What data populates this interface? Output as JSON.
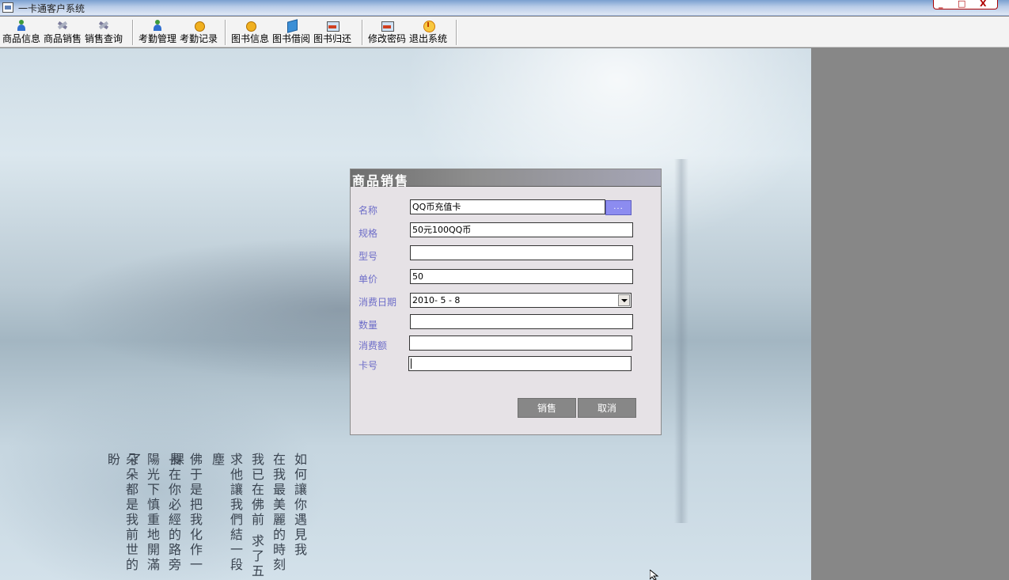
{
  "window": {
    "title": "一卡通客户系统",
    "controls": {
      "minimize": "_",
      "maximize": "□",
      "close": "X"
    }
  },
  "toolbar": {
    "groups": [
      [
        {
          "label": "商品信息",
          "icon": "person-icon"
        },
        {
          "label": "商品销售",
          "icon": "tools-icon"
        },
        {
          "label": "销售查询",
          "icon": "tools-icon"
        }
      ],
      [
        {
          "label": "考勤管理",
          "icon": "person-icon"
        },
        {
          "label": "考勤记录",
          "icon": "coin-icon"
        }
      ],
      [
        {
          "label": "图书信息",
          "icon": "coin-icon"
        },
        {
          "label": "图书借阅",
          "icon": "book-icon"
        },
        {
          "label": "图书归还",
          "icon": "picture-icon"
        }
      ],
      [
        {
          "label": "修改密码",
          "icon": "picture-icon"
        },
        {
          "label": "退出系统",
          "icon": "power-icon"
        }
      ]
    ]
  },
  "dialog": {
    "title": "商品销售",
    "fields": {
      "name": {
        "label": "名称",
        "value": "QQ币充值卡"
      },
      "spec": {
        "label": "规格",
        "value": "50元100QQ币"
      },
      "model": {
        "label": "型号",
        "value": ""
      },
      "price": {
        "label": "单价",
        "value": "50"
      },
      "date": {
        "label": "消费日期",
        "value": "2010- 5 - 8"
      },
      "quantity": {
        "label": "数量",
        "value": ""
      },
      "amount": {
        "label": "消费额",
        "value": ""
      },
      "card": {
        "label": "卡号",
        "value": ""
      }
    },
    "browse_label": "...",
    "sell_label": "销售",
    "cancel_label": "取消"
  },
  "background_poem": {
    "columns": [
      "如何讓你遇見我",
      "在我最美麗的時刻",
      "我已在佛前 求了五",
      "求他讓我們結一段塵",
      "",
      "佛于是把我化作一棵",
      "長在你必經的路旁",
      "陽光下慎重地開滿了",
      "朵朵都是我前世的盼"
    ]
  },
  "colors": {
    "dialog_bg": "#e6e2e6",
    "label_color": "#6d6dc8",
    "button_bg": "#878787",
    "browse_bg": "#8c8cf0"
  }
}
